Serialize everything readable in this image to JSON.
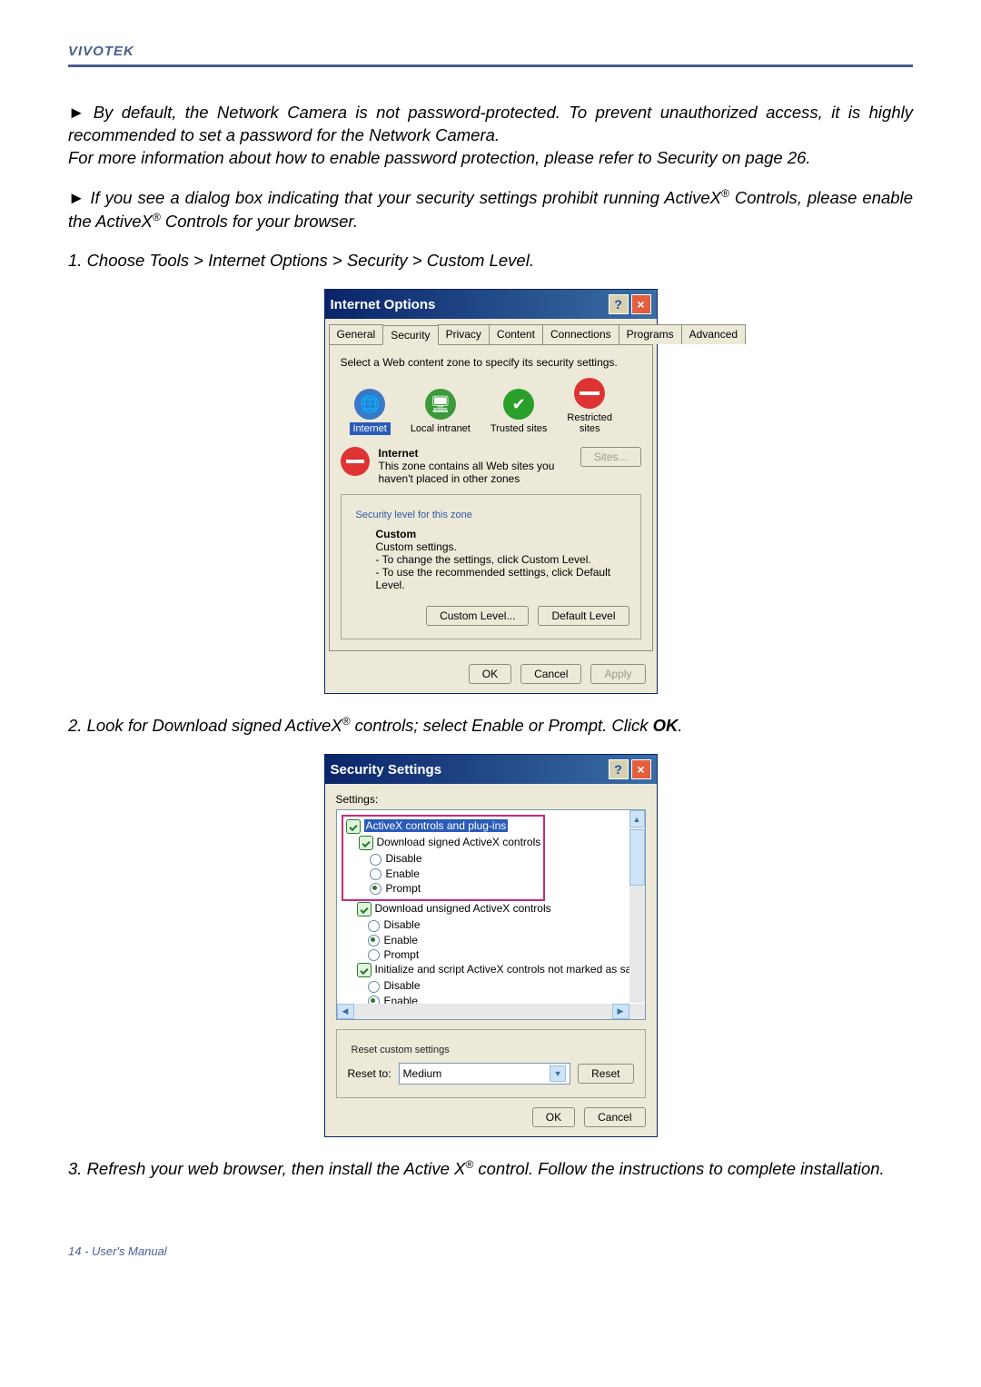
{
  "header": {
    "brand": "VIVOTEK"
  },
  "bullets": {
    "b1_part1": "By default, the Network Camera is not password-protected. To prevent unauthorized access, it is highly recommended to set a password for the Network Camera.",
    "b1_part2": "For more information about how to enable password protection, please refer to Security on page 26.",
    "b2_part1": "If you see a dialog box indicating that your security settings prohibit running ActiveX",
    "b2_part2": " Controls, please enable the ActiveX",
    "b2_part3": " Controls for your browser."
  },
  "steps": {
    "s1": "1. Choose Tools > Internet Options > Security > Custom Level.",
    "s2_part1": "2. Look for Download signed ActiveX",
    "s2_part2": " controls; select Enable or Prompt. Click ",
    "s2_ok": "OK",
    "s2_end": ".",
    "s3_part1": "3. Refresh your web browser, then install the Active X",
    "s3_part2": " control. Follow the instructions to complete installation."
  },
  "dialog1": {
    "title": "Internet Options",
    "tabs": [
      "General",
      "Security",
      "Privacy",
      "Content",
      "Connections",
      "Programs",
      "Advanced"
    ],
    "instruction": "Select a Web content zone to specify its security settings.",
    "zones": {
      "internet": "Internet",
      "intranet": "Local intranet",
      "trusted": "Trusted sites",
      "restricted_line1": "Restricted",
      "restricted_line2": "sites"
    },
    "zone_info": {
      "title": "Internet",
      "desc1": "This zone contains all Web sites you",
      "desc2": "haven't placed in other zones",
      "sites_btn": "Sites..."
    },
    "level_legend": "Security level for this zone",
    "custom": {
      "title": "Custom",
      "l1": "Custom settings.",
      "l2": "- To change the settings, click Custom Level.",
      "l3": "- To use the recommended settings, click Default Level."
    },
    "buttons": {
      "custom_level": "Custom Level...",
      "default_level": "Default Level",
      "ok": "OK",
      "cancel": "Cancel",
      "apply": "Apply"
    }
  },
  "dialog2": {
    "title": "Security Settings",
    "settings_label": "Settings:",
    "tree": {
      "cat1": "ActiveX controls and plug-ins",
      "i1": "Download signed ActiveX controls",
      "i2": "Download unsigned ActiveX controls",
      "i3": "Initialize and script ActiveX controls not marked as safe",
      "opt_disable": "Disable",
      "opt_enable": "Enable",
      "opt_prompt": "Prompt"
    },
    "reset_legend": "Reset custom settings",
    "reset_to": "Reset to:",
    "reset_value": "Medium",
    "reset_btn": "Reset",
    "ok": "OK",
    "cancel": "Cancel"
  },
  "footer": {
    "text": "14 - User's Manual"
  },
  "reg": "®"
}
